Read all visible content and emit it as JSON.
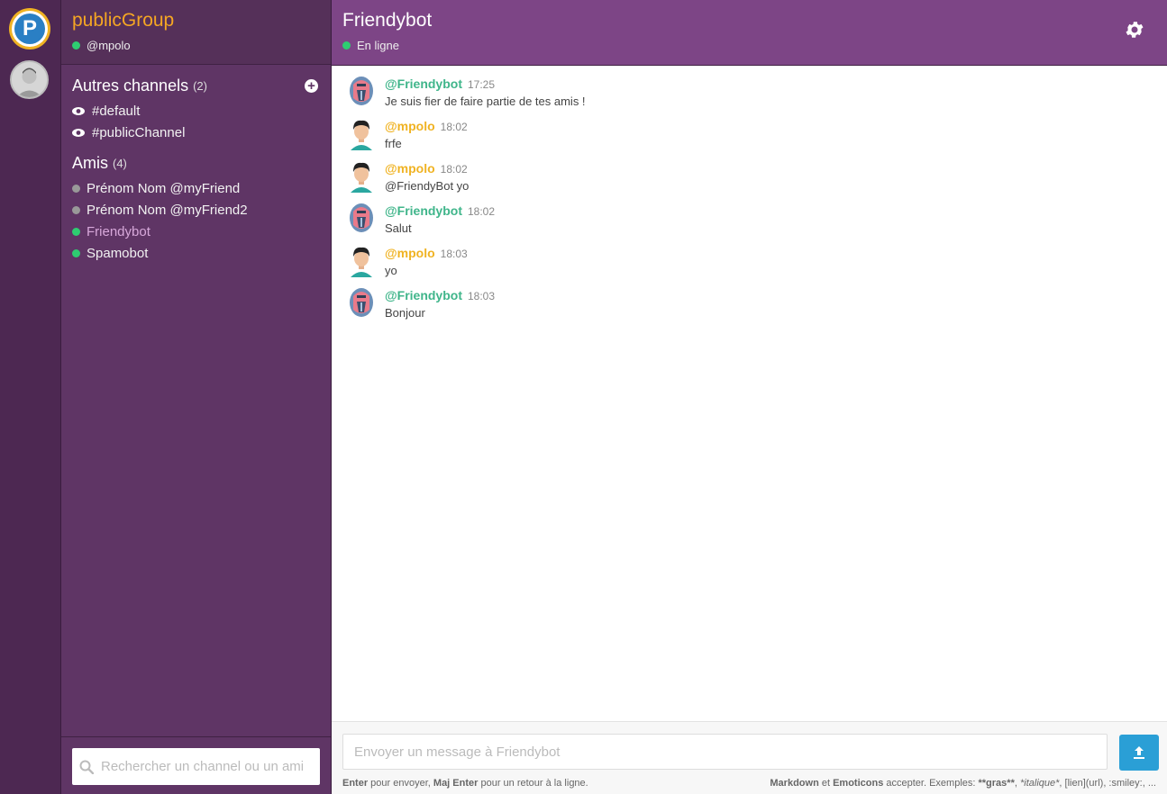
{
  "rail": {
    "logo_letter": "P",
    "logo_colors": {
      "ring": "#f0b323",
      "core": "#2a7fc4"
    }
  },
  "sidebar": {
    "group_name": "publicGroup",
    "current_user": "@mpolo",
    "channels_title": "Autres channels",
    "channels_count": "(2)",
    "channels": [
      {
        "label": "#default"
      },
      {
        "label": "#publicChannel"
      }
    ],
    "friends_title": "Amis",
    "friends_count": "(4)",
    "friends": [
      {
        "label": "Prénom Nom @myFriend",
        "status": "offline"
      },
      {
        "label": "Prénom Nom @myFriend2",
        "status": "offline"
      },
      {
        "label": "Friendybot",
        "status": "online",
        "active": true
      },
      {
        "label": "Spamobot",
        "status": "online"
      }
    ],
    "search_placeholder": "Rechercher un channel ou un ami"
  },
  "header": {
    "title": "Friendybot",
    "status": "En ligne"
  },
  "messages": [
    {
      "author": "@Friendybot",
      "time": "17:25",
      "text": "Je suis fier de faire partie de tes amis !",
      "kind": "bot"
    },
    {
      "author": "@mpolo",
      "time": "18:02",
      "text": "frfe",
      "kind": "me"
    },
    {
      "author": "@mpolo",
      "time": "18:02",
      "text": "@FriendyBot yo",
      "kind": "me"
    },
    {
      "author": "@Friendybot",
      "time": "18:02",
      "text": "Salut",
      "kind": "bot"
    },
    {
      "author": "@mpolo",
      "time": "18:03",
      "text": "yo",
      "kind": "me"
    },
    {
      "author": "@Friendybot",
      "time": "18:03",
      "text": "Bonjour",
      "kind": "bot"
    }
  ],
  "composer": {
    "placeholder": "Envoyer un message à Friendybot",
    "hint_left": {
      "k1": "Enter",
      "t1": " pour envoyer, ",
      "k2": "Maj Enter",
      "t2": " pour un retour à la ligne."
    },
    "hint_right": {
      "k1": "Markdown",
      "t1": " et ",
      "k2": "Emoticons",
      "t2": " accepter. Exemples: ",
      "ex_bold": "**gras**",
      "sep1": ", ",
      "ex_italic": "*italique*",
      "sep2": ", ",
      "ex_rest": "[lien](url), :smiley:, ..."
    }
  },
  "colors": {
    "rail_bg": "#4d2852",
    "sidebar_bg": "#5f3565",
    "header_bg": "#7d4586",
    "group_name": "#f5a623",
    "online": "#2ecc71",
    "bot_author": "#3fb58a",
    "me_author": "#f0b323",
    "send_button": "#2a9fd6"
  }
}
